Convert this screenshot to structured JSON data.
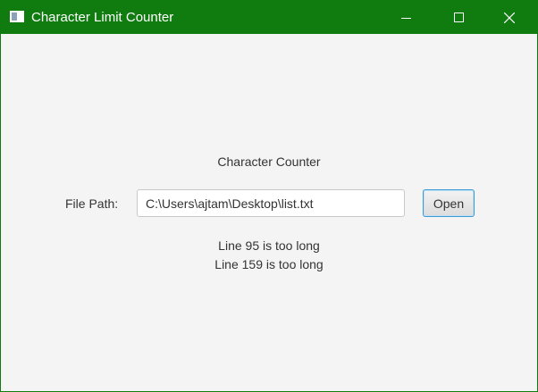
{
  "window": {
    "title": "Character Limit Counter",
    "titlebar_color": "#107c10",
    "icons": [
      "app-icon",
      "minimize-icon",
      "maximize-icon",
      "close-icon"
    ]
  },
  "form": {
    "heading": "Character Counter",
    "path_label": "File Path:",
    "path_value": "C:\\Users\\ajtam\\Desktop\\list.txt",
    "open_label": "Open"
  },
  "results": [
    "Line 95 is too long",
    "Line 159 is too long"
  ]
}
